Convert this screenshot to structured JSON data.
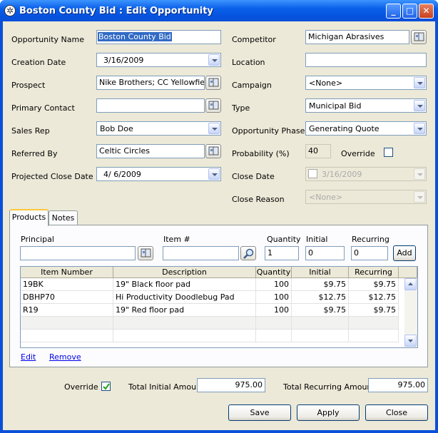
{
  "window": {
    "title": "Boston County Bid : Edit Opportunity"
  },
  "left": {
    "opportunity_name": {
      "label": "Opportunity Name",
      "value": "Boston County Bid"
    },
    "creation_date": {
      "label": "Creation Date",
      "value": "3/16/2009"
    },
    "prospect": {
      "label": "Prospect",
      "value": "Nike Brothers; CC Yellowfields"
    },
    "primary_contact": {
      "label": "Primary Contact",
      "value": ""
    },
    "sales_rep": {
      "label": "Sales Rep",
      "value": "Bob Doe"
    },
    "referred_by": {
      "label": "Referred By",
      "value": "Celtic Circles"
    },
    "projected_close_date": {
      "label": "Projected Close Date",
      "value": "4/  6/2009"
    }
  },
  "right": {
    "competitor": {
      "label": "Competitor",
      "value": "Michigan Abrasives"
    },
    "location": {
      "label": "Location",
      "value": ""
    },
    "campaign": {
      "label": "Campaign",
      "value": "<None>"
    },
    "type": {
      "label": "Type",
      "value": "Municipal Bid"
    },
    "opportunity_phase": {
      "label": "Opportunity Phase",
      "value": "Generating Quote"
    },
    "probability": {
      "label": "Probability (%)",
      "value": "40"
    },
    "override": {
      "label": "Override",
      "checked": false
    },
    "close_date": {
      "label": "Close Date",
      "value": "3/16/2009"
    },
    "close_reason": {
      "label": "Close Reason",
      "value": "<None>"
    }
  },
  "tabs": [
    {
      "label": "Products",
      "active": true
    },
    {
      "label": "Notes",
      "active": false
    }
  ],
  "products": {
    "principal_label": "Principal",
    "principal_value": "",
    "item_label": "Item #",
    "item_value": "",
    "quantity_label": "Quantity",
    "quantity_value": "1",
    "initial_label": "Initial",
    "initial_value": "0",
    "recurring_label": "Recurring",
    "recurring_value": "0",
    "add_label": "Add",
    "columns": [
      "Item Number",
      "Description",
      "Quantity",
      "Initial",
      "Recurring"
    ],
    "rows": [
      [
        "19BK",
        "19\" Black floor pad",
        "100",
        "$9.75",
        "$9.75"
      ],
      [
        "DBHP70",
        "Hi Productivity Doodlebug Pad",
        "100",
        "$12.75",
        "$12.75"
      ],
      [
        "R19",
        "19\" Red floor pad",
        "100",
        "$9.75",
        "$9.75"
      ]
    ],
    "edit_label": "Edit",
    "remove_label": "Remove"
  },
  "totals": {
    "override_label": "Override",
    "override_checked": true,
    "initial_label": "Total Initial Amount",
    "initial_value": "975.00",
    "recurring_label": "Total Recurring Amount",
    "recurring_value": "975.00"
  },
  "buttons": {
    "save": "Save",
    "apply": "Apply",
    "close": "Close"
  },
  "colors": {
    "title_bar": "#0a4fd8",
    "selection": "#316ac5",
    "tab_highlight": "#ffc83c"
  }
}
